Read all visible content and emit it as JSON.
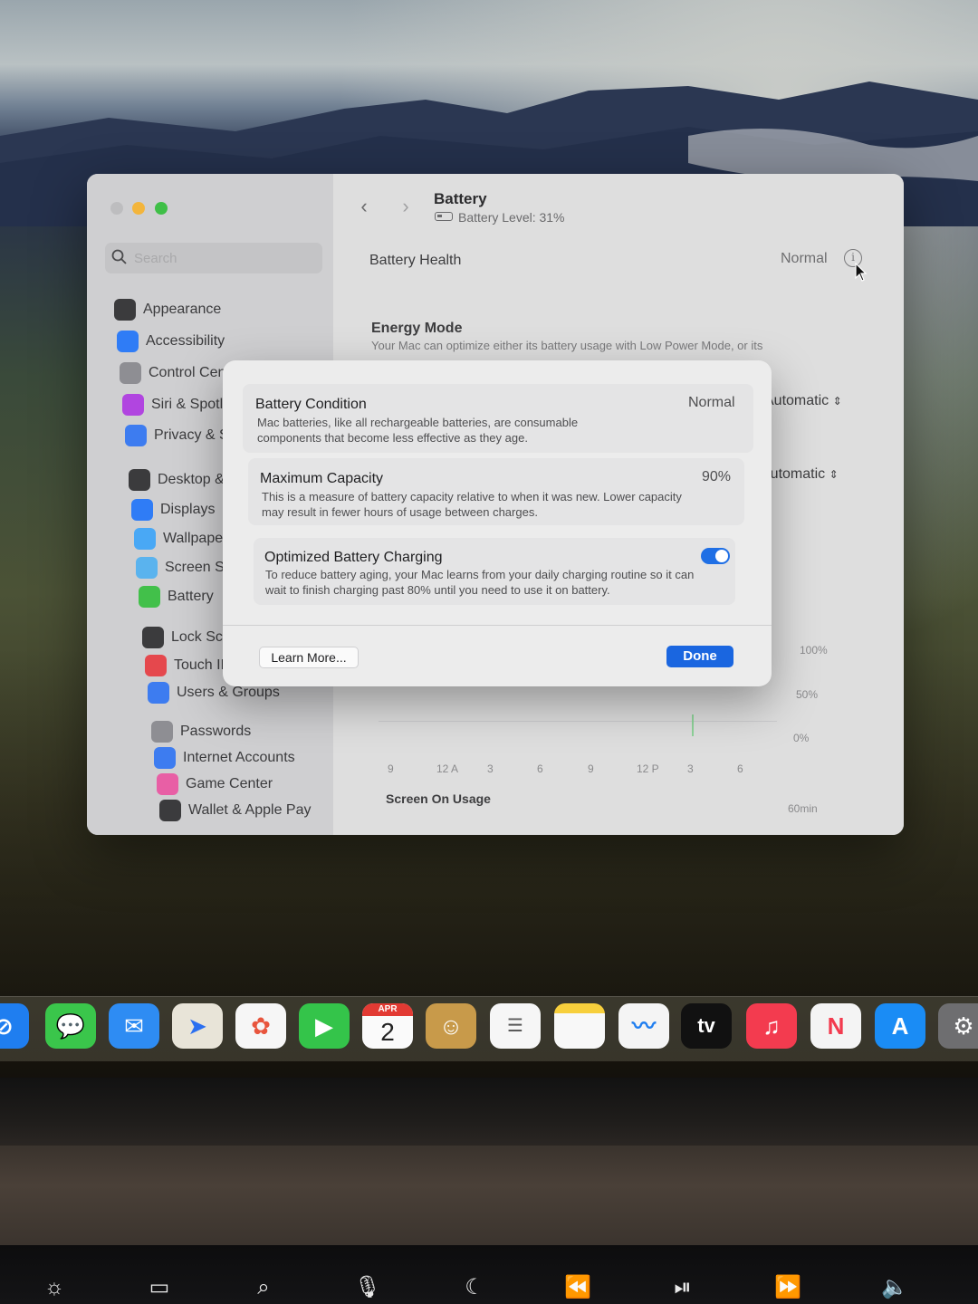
{
  "window": {
    "pane_title": "Battery",
    "pane_subtitle": "Battery Level: 31%",
    "search_placeholder": "Search"
  },
  "sidebar": {
    "items": [
      {
        "label": "Appearance",
        "icon": "appearance-icon",
        "color": "#3b3b3d"
      },
      {
        "label": "Accessibility",
        "icon": "accessibility-icon",
        "color": "#2f7cf6"
      },
      {
        "label": "Control Centre",
        "icon": "control-centre-icon",
        "color": "#8e8e93"
      },
      {
        "label": "Siri & Spotlight",
        "icon": "siri-icon",
        "color": "#b145e0"
      },
      {
        "label": "Privacy & Security",
        "icon": "hand-icon",
        "color": "#3d7cf0"
      },
      {
        "label": "Desktop & Dock",
        "icon": "desktop-dock-icon",
        "color": "#3b3b3d"
      },
      {
        "label": "Displays",
        "icon": "displays-icon",
        "color": "#2f7cf6"
      },
      {
        "label": "Wallpaper",
        "icon": "wallpaper-icon",
        "color": "#49a8f5"
      },
      {
        "label": "Screen Saver",
        "icon": "screen-saver-icon",
        "color": "#5ab3ee"
      },
      {
        "label": "Battery",
        "icon": "battery-icon",
        "color": "#42c04a"
      },
      {
        "label": "Lock Screen",
        "icon": "lock-icon",
        "color": "#3b3b3d"
      },
      {
        "label": "Touch ID & Password",
        "icon": "fingerprint-icon",
        "color": "#e5484d"
      },
      {
        "label": "Users & Groups",
        "icon": "users-icon",
        "color": "#3d7cf0"
      },
      {
        "label": "Passwords",
        "icon": "key-icon",
        "color": "#8e8e93"
      },
      {
        "label": "Internet Accounts",
        "icon": "at-icon",
        "color": "#3d7cf0"
      },
      {
        "label": "Game Center",
        "icon": "game-center-icon",
        "color": "#e85fa5"
      },
      {
        "label": "Wallet & Apple Pay",
        "icon": "wallet-icon",
        "color": "#3b3b3d"
      }
    ]
  },
  "content": {
    "battery_health_label": "Battery Health",
    "battery_health_value": "Normal",
    "energy_mode_label": "Energy Mode",
    "energy_mode_desc": "Your Mac can optimize either its battery usage with Low Power Mode, or its",
    "select_1_value": "Automatic",
    "select_2_value": "Automatic",
    "chart_y_labels": [
      "100%",
      "50%",
      "0%"
    ],
    "chart_x_labels": [
      "9",
      "12 A",
      "3",
      "6",
      "9",
      "12 P",
      "3",
      "6"
    ],
    "screen_on_usage_label": "Screen On Usage",
    "usage_axis_label": "60min"
  },
  "sheet": {
    "condition_title": "Battery Condition",
    "condition_value": "Normal",
    "condition_desc": "Mac batteries, like all rechargeable batteries, are consumable components that become less effective as they age.",
    "capacity_title": "Maximum Capacity",
    "capacity_value": "90%",
    "capacity_desc": "This is a measure of battery capacity relative to when it was new. Lower capacity may result in fewer hours of usage between charges.",
    "optimized_title": "Optimized Battery Charging",
    "optimized_desc": "To reduce battery aging, your Mac learns from your daily charging routine so it can wait to finish charging past 80% until you need to use it on battery.",
    "optimized_enabled": true,
    "learn_more_label": "Learn More...",
    "done_label": "Done"
  },
  "dock": {
    "calendar_month": "APR",
    "calendar_day": "2",
    "tv_label": "tv"
  },
  "colors": {
    "accent": "#1a66e0",
    "battery_green": "#42c04a"
  }
}
